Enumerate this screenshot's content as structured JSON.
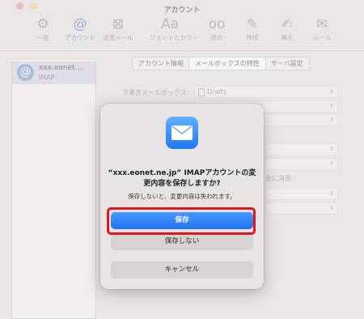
{
  "window": {
    "title": "アカウント"
  },
  "toolbar": {
    "items": [
      {
        "label": "一般",
        "icon": "gear-icon"
      },
      {
        "label": "アカウント",
        "icon": "at-icon"
      },
      {
        "label": "迷惑メール",
        "icon": "junk-icon"
      },
      {
        "label": "フォントとカラー",
        "icon": "fonts-icon"
      },
      {
        "label": "表示",
        "icon": "glasses-icon"
      },
      {
        "label": "作成",
        "icon": "compose-icon"
      },
      {
        "label": "署名",
        "icon": "signature-icon"
      },
      {
        "label": "ルール",
        "icon": "rules-icon"
      }
    ]
  },
  "sidebar": {
    "account_name": "xxx.eonet....",
    "account_type": "IMAP"
  },
  "tabs": [
    "アカウント情報",
    "メールボックスの特性",
    "サーバ設定"
  ],
  "form": {
    "drafts_label": "下書きメールボックス:",
    "drafts_value": "Drafts",
    "partial_label": "全に消去:"
  },
  "dialog": {
    "title": "“xxx.eonet.ne.jp” IMAPアカウントの変更内容を保存しますか?",
    "message": "保存しないと、変更内容は失われます。",
    "save_label": "保存",
    "dont_save_label": "保存しない",
    "cancel_label": "キャンセル"
  },
  "colors": {
    "accent": "#1f74f2",
    "highlight": "#e0161b"
  }
}
